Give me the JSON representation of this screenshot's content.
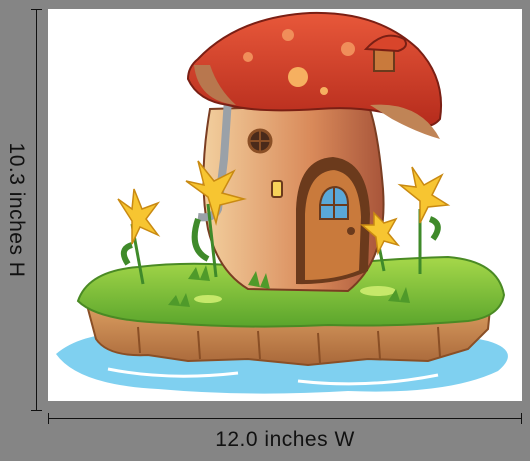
{
  "dimensions": {
    "height_label": "10.3 inches H",
    "width_label": "12.0 inches W"
  },
  "colors": {
    "background": "#858585",
    "canvas": "#ffffff",
    "cap": "#d8452b",
    "grass": "#8cc63f",
    "water": "#6ec6ea",
    "flower": "#f7c531"
  }
}
